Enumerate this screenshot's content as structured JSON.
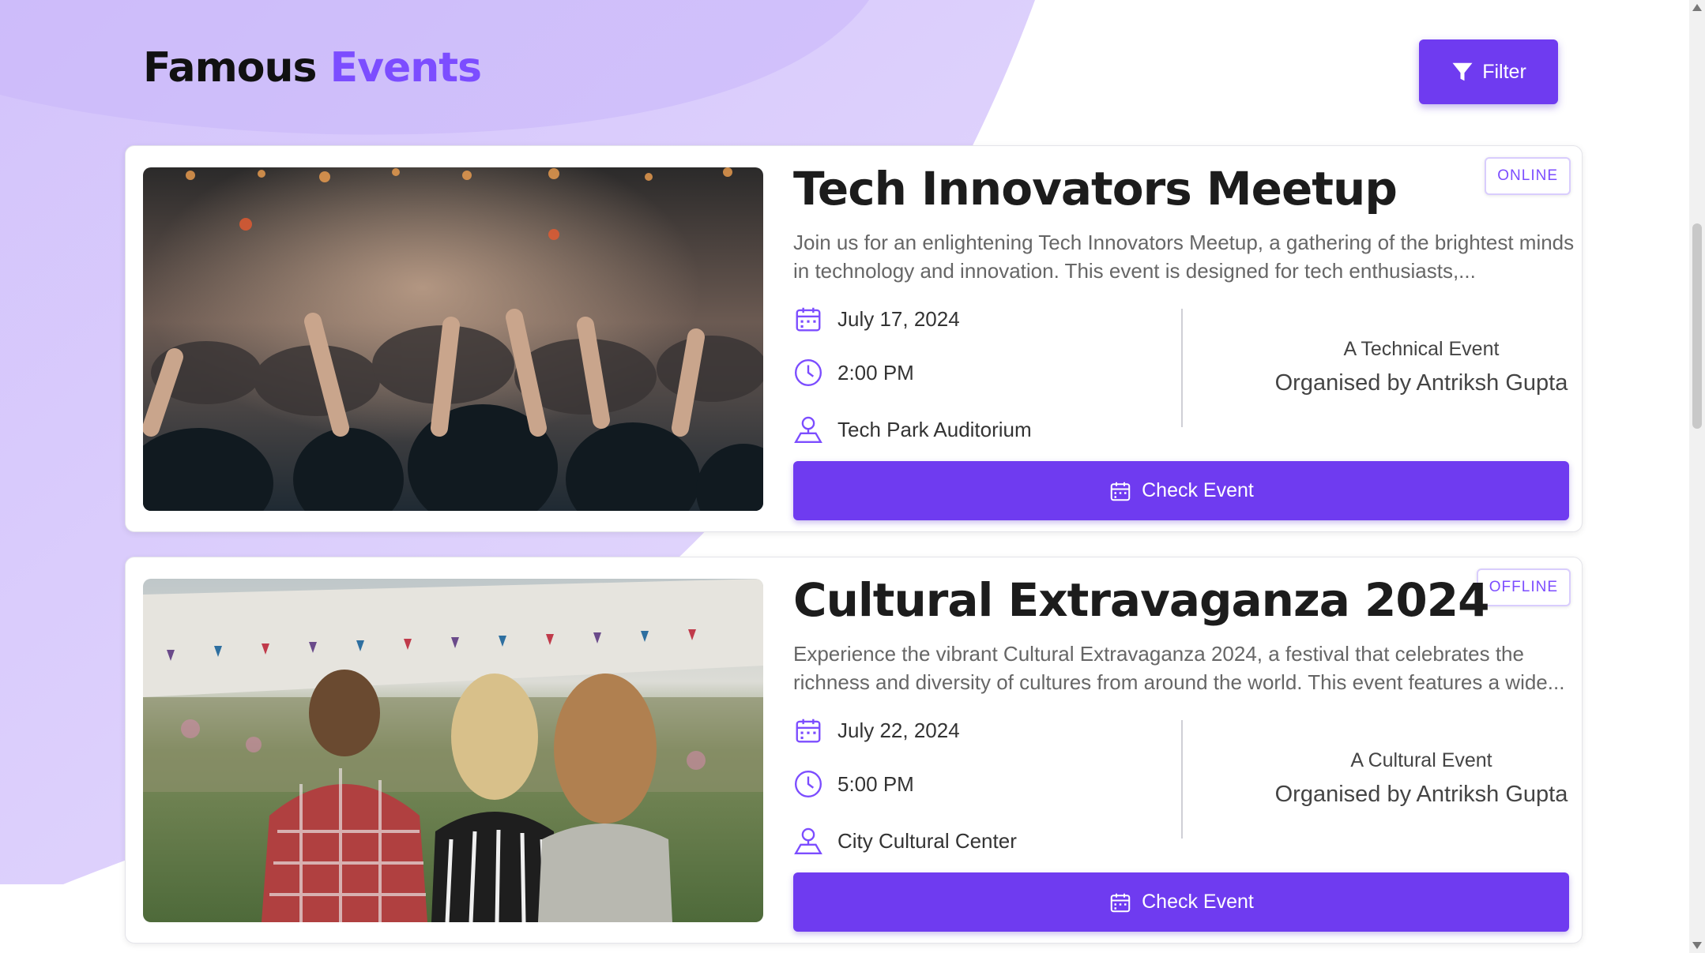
{
  "header": {
    "title_part1": "Famous",
    "title_part2": "Events",
    "filter_label": "Filter"
  },
  "colors": {
    "accent": "#7c4dff",
    "button": "#6f3bf0",
    "blob": "#ddd0fd"
  },
  "events": [
    {
      "badge": "ONLINE",
      "title": "Tech Innovators Meetup",
      "description": "Join us for an enlightening Tech Innovators Meetup, a gathering of the brightest minds in technology and innovation. This event is designed for tech enthusiasts,...",
      "date": "July 17, 2024",
      "time": "2:00 PM",
      "venue": "Tech Park Auditorium",
      "type": "A Technical Event",
      "organiser": "Organised by Antriksh Gupta",
      "button_label": "Check Event",
      "image_icon": "concert-crowd-photo"
    },
    {
      "badge": "OFFLINE",
      "title": "Cultural Extravaganza 2024",
      "description": "Experience the vibrant Cultural Extravaganza 2024, a festival that celebrates the richness and diversity of cultures from around the world. This event features a wide...",
      "date": "July 22, 2024",
      "time": "5:00 PM",
      "venue": "City Cultural Center",
      "type": "A Cultural Event",
      "organiser": "Organised by Antriksh Gupta",
      "button_label": "Check Event",
      "image_icon": "festival-crowd-photo"
    }
  ]
}
